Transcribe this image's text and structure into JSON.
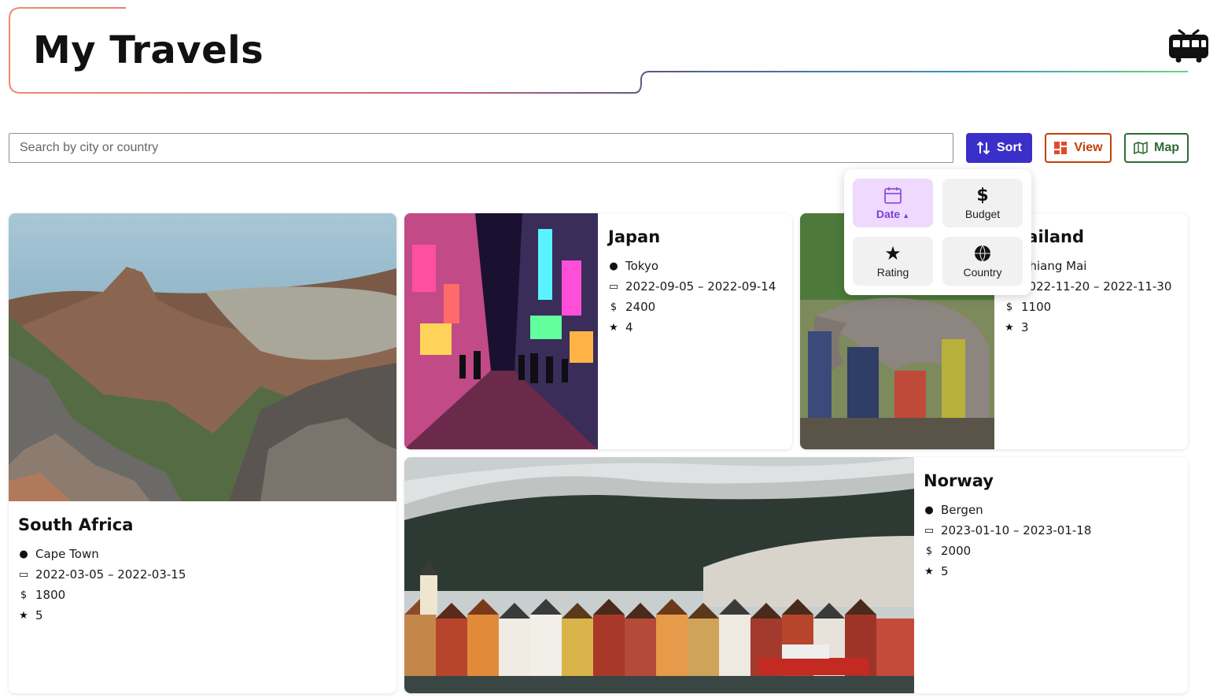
{
  "header": {
    "title": "My Travels"
  },
  "search": {
    "placeholder": "Search by city or country",
    "value": ""
  },
  "toolbar": {
    "sort_label": "Sort",
    "view_label": "View",
    "map_label": "Map"
  },
  "sort_menu": {
    "options": [
      {
        "label": "Date",
        "icon": "calendar-icon",
        "active": true,
        "direction": "▲"
      },
      {
        "label": "Budget",
        "icon": "dollar-icon",
        "active": false
      },
      {
        "label": "Rating",
        "icon": "star-icon",
        "active": false
      },
      {
        "label": "Country",
        "icon": "globe-icon",
        "active": false
      }
    ]
  },
  "trips": [
    {
      "country": "South Africa",
      "city": "Cape Town",
      "dates": "2022-03-05 – 2022-03-15",
      "budget": "1800",
      "rating": "5"
    },
    {
      "country": "Japan",
      "city": "Tokyo",
      "dates": "2022-09-05 – 2022-09-14",
      "budget": "2400",
      "rating": "4"
    },
    {
      "country": "Thailand",
      "city": "Chiang Mai",
      "dates": "2022-11-20 – 2022-11-30",
      "budget": "1100",
      "rating": "3"
    },
    {
      "country": "Norway",
      "city": "Bergen",
      "dates": "2023-01-10 – 2023-01-18",
      "budget": "2000",
      "rating": "5"
    }
  ],
  "colors": {
    "sort_button": "#3b2fc9",
    "view_button": "#c2410c",
    "map_button": "#2f6b34",
    "active_sort": "#efd9ff"
  }
}
